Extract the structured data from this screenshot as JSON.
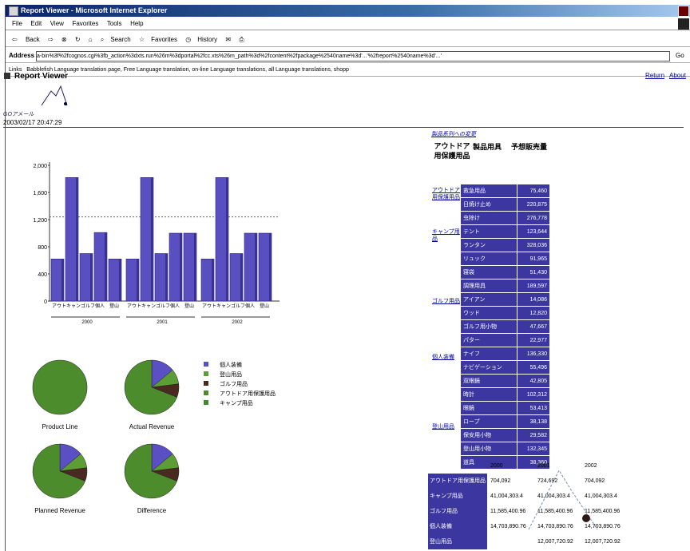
{
  "window": {
    "title": "Report Viewer - Microsoft Internet Explorer"
  },
  "menu": [
    "File",
    "Edit",
    "View",
    "Favorites",
    "Tools",
    "Help"
  ],
  "toolbar": [
    "Back",
    "Search",
    "Favorites",
    "History"
  ],
  "address": {
    "label": "Address",
    "url": "a-bin%3f%2fcognos.cgi%3fb_action%3dxts.run%26m%3dportal%2fcc.xts%26m_path%3d%2fcontent%2fpackage%2540name%3d'...'%2freport%2540name%3d'...'",
    "go": "Go"
  },
  "links": {
    "label": "Links",
    "text": "Babblefish Language translation page, Free Language translation, on-line Language translations, all Language translations, shopp"
  },
  "viewer": {
    "title": "Report Viewer",
    "links": [
      "Return",
      "About"
    ],
    "logo_text": "GOアメール",
    "timestamp": "2003/02/17 20:47:29"
  },
  "chart_data": [
    {
      "type": "bar",
      "title": "",
      "ylim": [
        0,
        2000
      ],
      "yticks": [
        "2,000",
        "1,600",
        "1,200",
        "800",
        "400",
        "0"
      ],
      "yticks_values": [
        2000,
        1600,
        1200,
        800,
        400,
        0
      ],
      "groups": [
        "2000",
        "2001",
        "2002"
      ],
      "categories": [
        "アウトドア用",
        "キャンプ用品",
        "ゴルフ用品",
        "個人装備",
        "登山用品"
      ],
      "cat_short": [
        "アウト",
        "キャン",
        "ゴルフ",
        "個人",
        "登山"
      ],
      "values": [
        [
          620,
          1820,
          700,
          1010,
          620
        ],
        [
          620,
          1820,
          700,
          1000,
          1000
        ],
        [
          620,
          1820,
          700,
          1000,
          1000
        ]
      ],
      "refline": 1240
    },
    {
      "type": "pie",
      "charts": [
        {
          "label": "Actual Revenue",
          "slices": [
            14,
            9,
            8,
            69
          ]
        },
        {
          "label": "Product Line",
          "slices": [
            0,
            0,
            0,
            100
          ]
        },
        {
          "label": "Planned Revenue",
          "slices": [
            14,
            9,
            8,
            69
          ]
        },
        {
          "label": "Difference",
          "slices": [
            14,
            9,
            8,
            69
          ]
        }
      ],
      "legend": [
        {
          "name": "個人装備",
          "color": "#5b4fc4"
        },
        {
          "name": "登山用品",
          "color": "#5c9d35"
        },
        {
          "name": "ゴルフ用品",
          "color": "#4a2a20"
        },
        {
          "name": "アウトドア用保護用品",
          "color": "#4d8c2d"
        },
        {
          "name": "キャンプ用品",
          "color": "#3f8a2a"
        }
      ]
    }
  ],
  "report_table": {
    "title": "製品系列への変更",
    "headers": [
      "アウトドア用保護用品",
      "製品用具",
      "予想販売量"
    ],
    "groups": [
      {
        "label": "アウトドア用保護用品",
        "rows": [
          [
            "救急用品",
            "75,460"
          ],
          [
            "日焼け止め",
            "220,875"
          ],
          [
            "虫除け",
            "276,778"
          ]
        ]
      },
      {
        "label": "キャンプ用品",
        "rows": [
          [
            "テント",
            "123,644"
          ],
          [
            "ランタン",
            "328,036"
          ],
          [
            "リュック",
            "91,965"
          ],
          [
            "寝袋",
            "51,430"
          ],
          [
            "調理用具",
            "189,597"
          ]
        ]
      },
      {
        "label": "ゴルフ用品",
        "rows": [
          [
            "アイアン",
            "14,086"
          ],
          [
            "ウッド",
            "12,820"
          ],
          [
            "ゴルフ用小物",
            "47,667"
          ],
          [
            "パター",
            "22,977"
          ]
        ]
      },
      {
        "label": "個人装備",
        "rows": [
          [
            "ナイフ",
            "136,330"
          ],
          [
            "ナビゲーション",
            "55,496"
          ],
          [
            "双眼鏡",
            "42,805"
          ],
          [
            "時計",
            "102,312"
          ],
          [
            "眼鏡",
            "53,413"
          ]
        ]
      },
      {
        "label": "登山用品",
        "rows": [
          [
            "ロープ",
            "38,138"
          ],
          [
            "保安用小物",
            "29,582"
          ],
          [
            "登山用小物",
            "132,345"
          ],
          [
            "道具",
            "38,360"
          ]
        ]
      }
    ]
  },
  "crosstab": {
    "years": [
      "2000",
      "2001",
      "2002"
    ],
    "rows": [
      {
        "label": "アウトドア用保護用品",
        "values": [
          "704,092",
          "724,692",
          "704,092"
        ]
      },
      {
        "label": "キャンプ用品",
        "values": [
          "41,004,303.4",
          "41,004,303.4",
          "41,004,303.4"
        ]
      },
      {
        "label": "ゴルフ用品",
        "values": [
          "11,585,400.96",
          "11,585,400.96",
          "11,585,400.96"
        ]
      },
      {
        "label": "個人装備",
        "values": [
          "14,703,890.76",
          "14,703,890.76",
          "14,703,890.76"
        ]
      },
      {
        "label": "登山用品",
        "values": [
          "",
          "12,007,720.92",
          "12,007,720.92"
        ]
      }
    ]
  }
}
